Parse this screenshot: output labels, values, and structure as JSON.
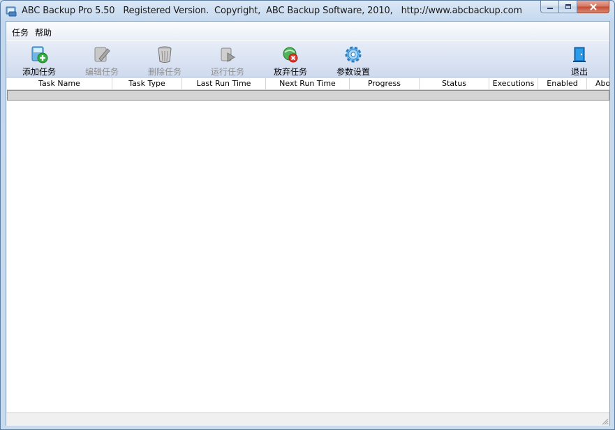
{
  "window": {
    "title": "ABC Backup Pro 5.50   Registered Version.  Copyright,  ABC Backup Software, 2010,   http://www.abcbackup.com"
  },
  "menu": [
    {
      "label": "任务"
    },
    {
      "label": "帮助"
    }
  ],
  "toolbar": {
    "add_task": {
      "label": "添加任务",
      "icon": "add-task-icon",
      "enabled": true
    },
    "edit_task": {
      "label": "编辑任务",
      "icon": "edit-task-icon",
      "enabled": false
    },
    "delete_task": {
      "label": "删除任务",
      "icon": "delete-task-icon",
      "enabled": false
    },
    "run_task": {
      "label": "运行任务",
      "icon": "run-task-icon",
      "enabled": false
    },
    "abort_task": {
      "label": "放弃任务",
      "icon": "abort-task-icon",
      "enabled": true
    },
    "settings": {
      "label": "参数设置",
      "icon": "settings-gear-icon",
      "enabled": true
    },
    "exit": {
      "label": "退出",
      "icon": "exit-door-icon",
      "enabled": true
    }
  },
  "table": {
    "columns": [
      {
        "label": "Task Name"
      },
      {
        "label": "Task Type"
      },
      {
        "label": "Last Run Time"
      },
      {
        "label": "Next Run Time"
      },
      {
        "label": "Progress"
      },
      {
        "label": "Status"
      },
      {
        "label": "Executions"
      },
      {
        "label": "Enabled"
      },
      {
        "label": "Abort"
      }
    ],
    "rows": []
  },
  "colors": {
    "accent": "#c44b32",
    "toolbar_bg": "#d9e2f2",
    "frame": "#c4d8ee"
  }
}
